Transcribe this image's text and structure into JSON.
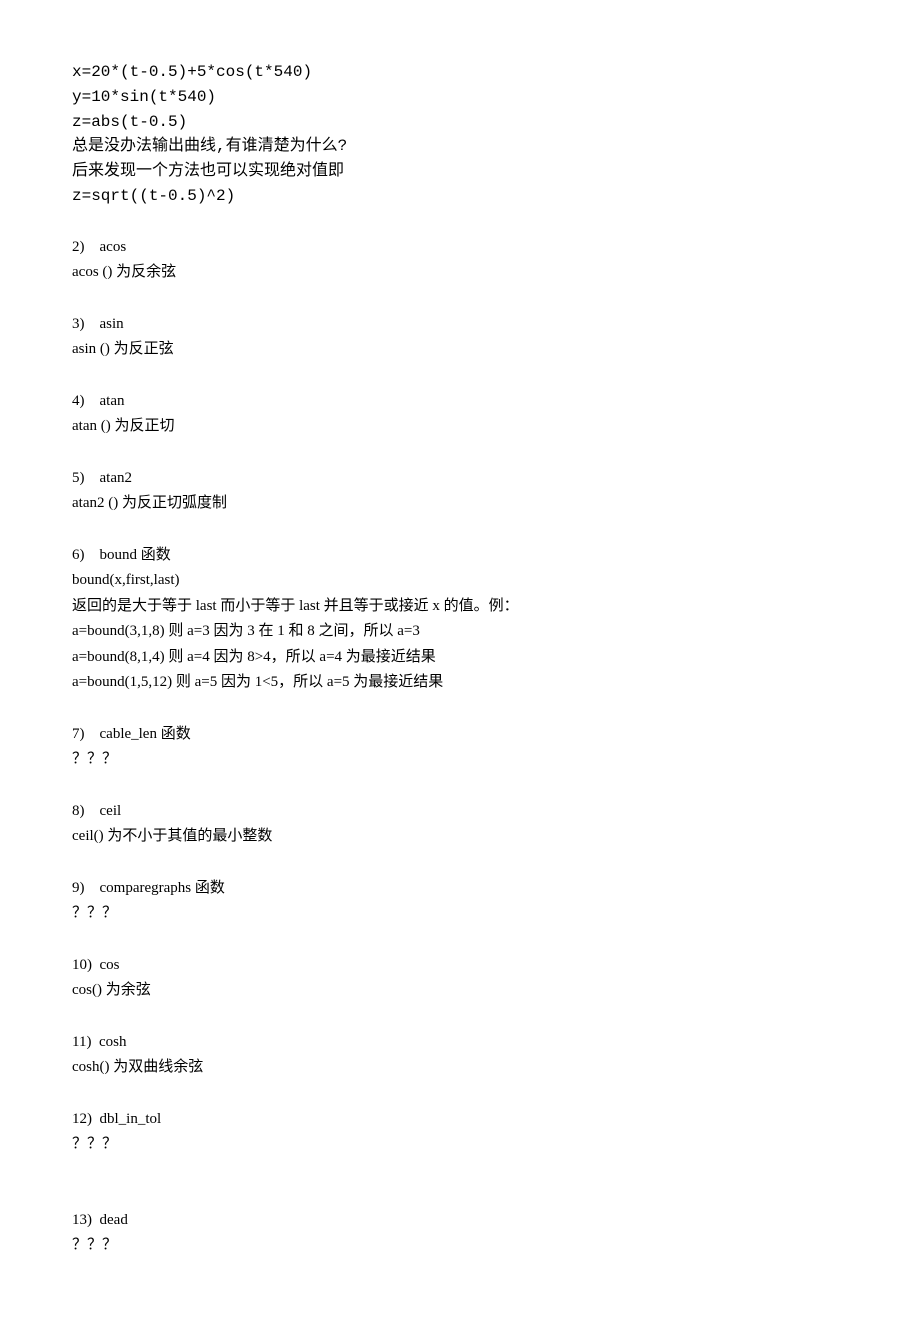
{
  "intro": {
    "lines": [
      "x=20*(t-0.5)+5*cos(t*540)",
      "y=10*sin(t*540)",
      "z=abs(t-0.5)",
      "总是没办法输出曲线,有谁清楚为什么?",
      "后来发现一个方法也可以实现绝对值即",
      "z=sqrt((t-0.5)^2)"
    ]
  },
  "sections": [
    {
      "num": "2)",
      "title": "acos",
      "lines": [
        "acos ()  为反余弦"
      ]
    },
    {
      "num": "3)",
      "title": "asin",
      "lines": [
        "asin ()  为反正弦"
      ]
    },
    {
      "num": "4)",
      "title": "atan",
      "lines": [
        "atan ()  为反正切"
      ]
    },
    {
      "num": "5)",
      "title": "atan2",
      "lines": [
        "atan2 ()  为反正切弧度制"
      ]
    },
    {
      "num": "6)",
      "title": "bound 函数",
      "lines": [
        "bound(x,first,last)",
        "返回的是大于等于 last 而小于等于 last 并且等于或接近 x 的值。例：",
        "a=bound(3,1,8)  则 a=3  因为 3 在 1 和 8 之间，所以 a=3",
        "a=bound(8,1,4)  则 a=4  因为 8>4，所以 a=4 为最接近结果",
        "a=bound(1,5,12)  则 a=5  因为 1<5，所以 a=5 为最接近结果"
      ]
    },
    {
      "num": "7)",
      "title": "cable_len 函数",
      "lines": [
        "？？？"
      ]
    },
    {
      "num": "8)",
      "title": "ceil",
      "lines": [
        "ceil()  为不小于其值的最小整数"
      ]
    },
    {
      "num": "9)",
      "title": "comparegraphs 函数",
      "lines": [
        "？？？"
      ]
    },
    {
      "num": "10)",
      "title": "cos",
      "lines": [
        "cos()  为余弦"
      ]
    },
    {
      "num": "11)",
      "title": "cosh",
      "lines": [
        "cosh()  为双曲线余弦"
      ]
    },
    {
      "num": "12)",
      "title": "dbl_in_tol",
      "lines": [
        "？？？"
      ]
    },
    {
      "num": "13)",
      "title": "dead",
      "lines": [
        "？？？"
      ]
    }
  ]
}
